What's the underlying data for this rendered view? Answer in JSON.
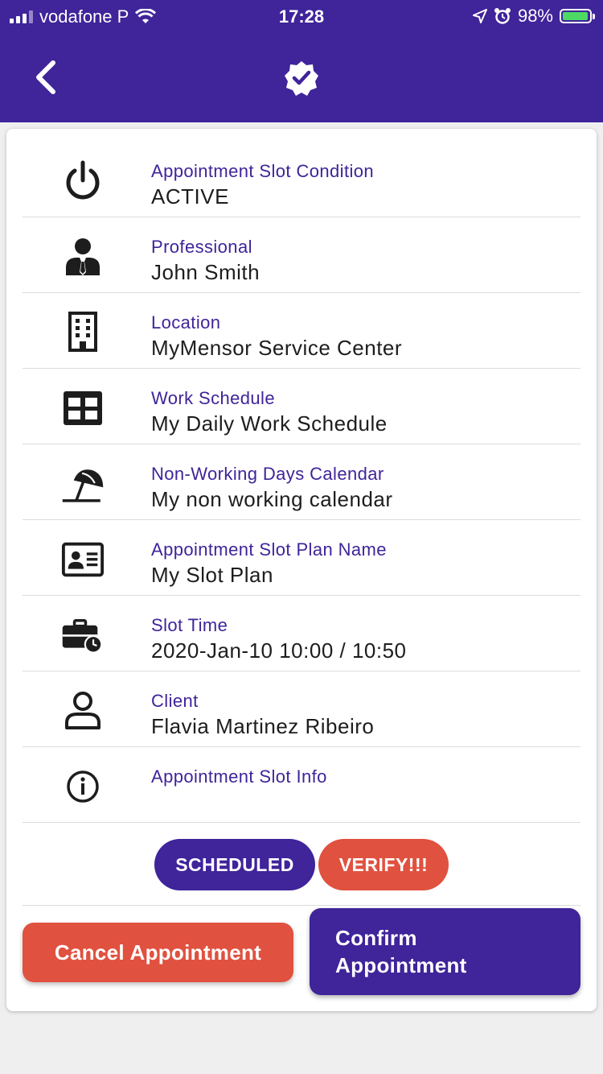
{
  "status_bar": {
    "carrier": "vodafone P",
    "time": "17:28",
    "battery": "98%",
    "battery_level": 0.98
  },
  "header": {
    "back_icon": "chevron-left-icon",
    "badge_icon": "verified-badge-icon"
  },
  "details": [
    {
      "icon": "power-icon",
      "label": "Appointment Slot Condition",
      "value": "ACTIVE"
    },
    {
      "icon": "person-tie-icon",
      "label": "Professional",
      "value": "John Smith"
    },
    {
      "icon": "building-icon",
      "label": "Location",
      "value": "MyMensor Service Center"
    },
    {
      "icon": "grid-icon",
      "label": "Work Schedule",
      "value": "My Daily Work Schedule"
    },
    {
      "icon": "beach-umbrella-icon",
      "label": "Non-Working Days Calendar",
      "value": "My non working calendar"
    },
    {
      "icon": "id-card-icon",
      "label": "Appointment Slot Plan Name",
      "value": "My Slot Plan"
    },
    {
      "icon": "briefcase-clock-icon",
      "label": "Slot Time",
      "value": "2020-Jan-10 10:00 / 10:50"
    },
    {
      "icon": "user-outline-icon",
      "label": "Client",
      "value": "Flavia Martinez Ribeiro"
    },
    {
      "icon": "info-icon",
      "label": "Appointment Slot Info",
      "value": ""
    }
  ],
  "badges": {
    "scheduled": "SCHEDULED",
    "verify": "VERIFY!!!"
  },
  "actions": {
    "cancel": "Cancel Appointment",
    "confirm_line1": "Confirm",
    "confirm_line2": "Appointment"
  },
  "colors": {
    "primary": "#3f249a",
    "danger": "#e0513f",
    "battery": "#4cd964"
  }
}
